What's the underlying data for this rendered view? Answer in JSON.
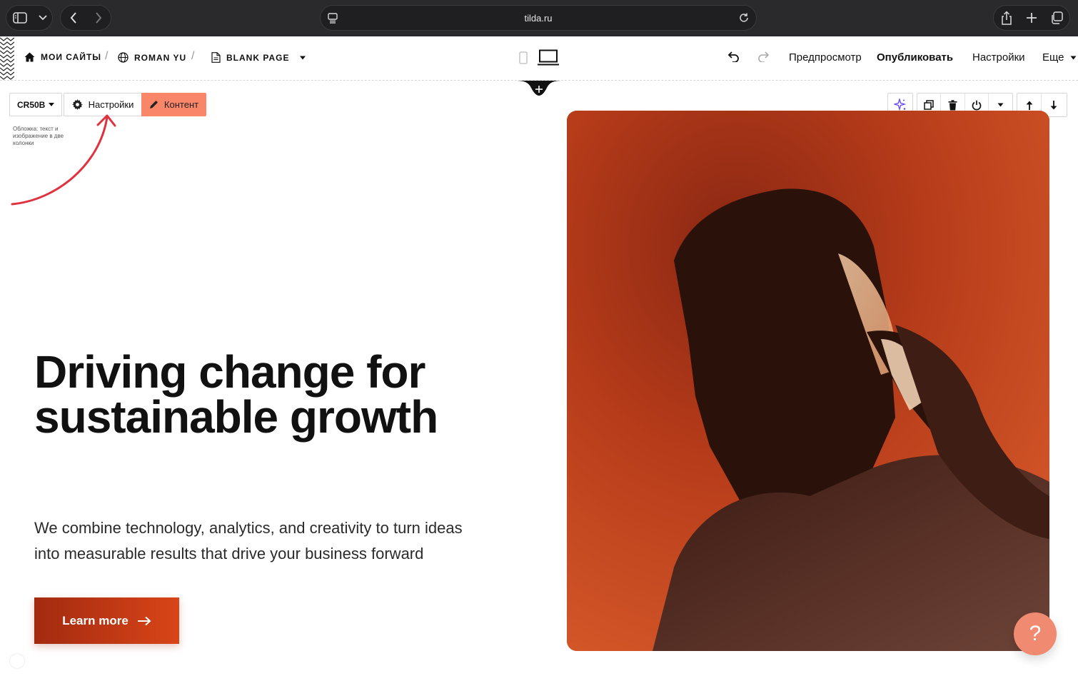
{
  "browser": {
    "url": "tilda.ru"
  },
  "topbar": {
    "breadcrumbs": [
      {
        "label": "Мои сайты",
        "icon": "home-icon"
      },
      {
        "label": "Roman Yu",
        "icon": "globe-icon"
      },
      {
        "label": "Blank Page",
        "icon": "page-icon"
      }
    ],
    "preview_label": "Предпросмотр",
    "publish_label": "Опубликовать",
    "settings_label": "Настройки",
    "more_label": "Еще"
  },
  "block_toolbar": {
    "code": "CR50B",
    "settings_label": "Настройки",
    "content_label": "Контент",
    "description": "Обложка: текст и изображение в две колонки"
  },
  "hero": {
    "title": "Driving change for sustainable growth",
    "subtitle": "We combine technology, analytics, and creativity to turn ideas into measurable results that drive your business forward",
    "cta_label": "Learn more"
  },
  "help_label": "?",
  "colors": {
    "accent": "#fa8669",
    "cta_start": "#a32a10",
    "cta_end": "#d84518",
    "photo_bg": "#b33a19",
    "annotation": "#e0313e",
    "chrome": "#2a2a2c"
  }
}
